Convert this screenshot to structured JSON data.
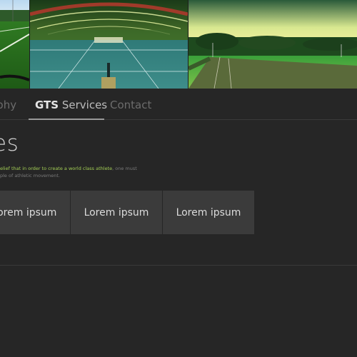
{
  "banner": {
    "photos": [
      {
        "name": "sports-field-photo"
      },
      {
        "name": "indoor-tennis-hall-photo"
      },
      {
        "name": "running-track-photo"
      }
    ]
  },
  "nav": {
    "items": [
      {
        "label": "ophy"
      },
      {
        "label_bold": "GTS",
        "label_rest": " Services",
        "active": true
      },
      {
        "label": "Contact"
      }
    ]
  },
  "section": {
    "title": "es",
    "intro_highlight": "elief that in order to create a world class athlete",
    "intro_rest_1": ", one must",
    "intro_line2": "ple of athletic movement."
  },
  "tiles": [
    {
      "label": "Lorem ipsum"
    },
    {
      "label": "Lorem ipsum"
    },
    {
      "label": "Lorem ipsum"
    }
  ],
  "colors": {
    "background": "#262626",
    "tile": "#3b3b3b",
    "accent_green": "#a4cf55",
    "nav_inactive": "#6c6c6c"
  }
}
